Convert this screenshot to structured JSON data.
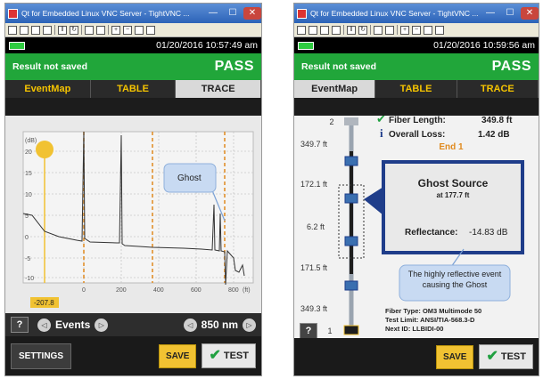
{
  "left": {
    "window_title": "Qt for Embedded Linux VNC Server - TightVNC ...",
    "datetime": "01/20/2016 10:57:49 am",
    "result_message": "Result not saved",
    "result_status": "PASS",
    "tabs": [
      "EventMap",
      "TABLE",
      "TRACE"
    ],
    "active_tab": "TRACE",
    "trace": {
      "y_unit": "(dB)",
      "y_ticks": [
        "20",
        "15",
        "10",
        "5",
        "0",
        "-5",
        "-10"
      ],
      "x_ticks": [
        "0",
        "200",
        "400",
        "600",
        "800"
      ],
      "x_unit": "(ft)",
      "cursor_label": "-207.8",
      "callout": "Ghost"
    },
    "controls": {
      "help": "?",
      "events_label": "Events",
      "wavelength": "850 nm",
      "prev_glyph": "◁",
      "next_glyph": "▷"
    },
    "footer": {
      "settings": "SETTINGS",
      "save": "SAVE",
      "test": "TEST",
      "check_glyph": "✔"
    }
  },
  "right": {
    "window_title": "Qt for Embedded Linux VNC Server - TightVNC ...",
    "datetime": "01/20/2016 10:59:56 am",
    "result_message": "Result not saved",
    "result_status": "PASS",
    "tabs": [
      "EventMap",
      "TABLE",
      "TRACE"
    ],
    "active_tab": "EventMap",
    "fiber_length_label": "Fiber Length:",
    "fiber_length_value": "349.8 ft",
    "overall_loss_label": "Overall Loss:",
    "overall_loss_value": "1.42 dB",
    "end_label": "End 1",
    "top_marker": "2",
    "bottom_marker": "1",
    "distances": [
      "349.7 ft",
      "172.1 ft",
      "6.2 ft",
      "171.5 ft",
      "349.3 ft"
    ],
    "event_box": {
      "title": "Ghost Source",
      "subtitle": "at 177.7 ft",
      "reflectance_label": "Reflectance:",
      "reflectance_value": "-14.83 dB"
    },
    "callout": "The highly reflective event causing the Ghost",
    "fiber_type": "Fiber Type: OM3 Multimode 50",
    "test_limit": "Test Limit: ANSI/TIA-568.3-D",
    "next_id": "Next ID: LLBIDI-00",
    "help": "?",
    "footer": {
      "save": "SAVE",
      "test": "TEST",
      "check_glyph": "✔"
    }
  },
  "colors": {
    "pass_green": "#21a63a",
    "tab_text": "#f5c400",
    "save_yellow": "#f1c232",
    "callout_blue": "#c8daf2",
    "info_blue": "#1f3d8a",
    "trace_orange": "#e08a1e"
  },
  "toolbar_icons": [
    "new-icon",
    "save-icon",
    "copy-icon",
    "paste-icon",
    "pause-icon",
    "refresh-icon",
    "options-icon",
    "ctrl-alt-del-icon",
    "zoom-in-icon",
    "zoom-out-icon",
    "zoom-fit-icon",
    "fullscreen-icon"
  ]
}
